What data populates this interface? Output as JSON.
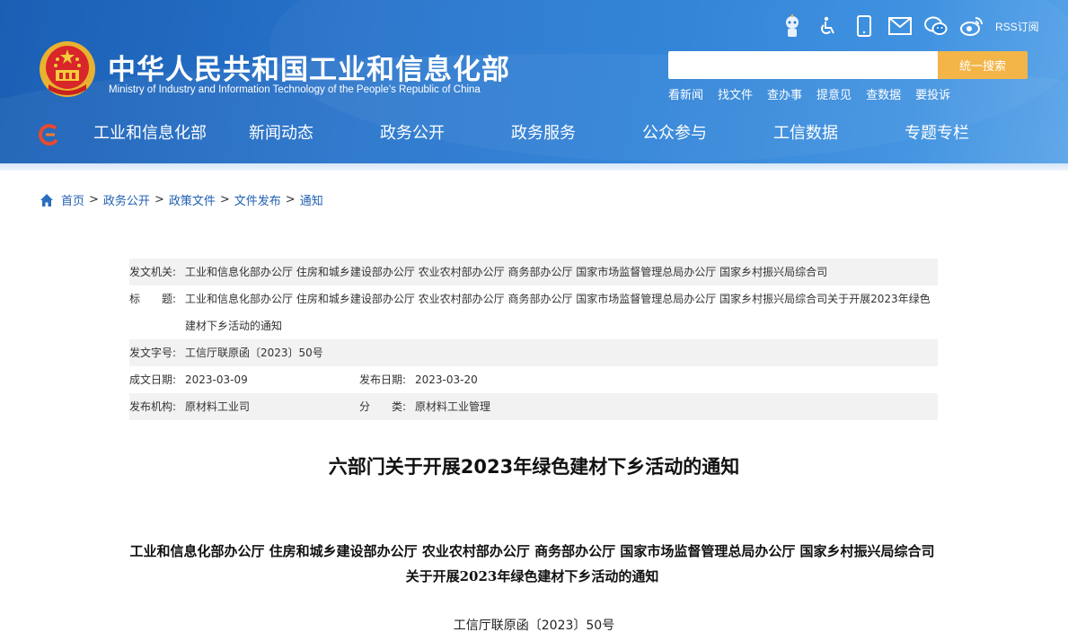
{
  "header": {
    "title": "中华人民共和国工业和信息化部",
    "subtitle": "Ministry of Industry and Information Technology of the People’s Republic of China",
    "rss_label": "RSS订阅",
    "tool_icons": [
      "robot-assistant-icon",
      "accessibility-icon",
      "mobile-icon",
      "mail-icon",
      "wechat-icon",
      "weibo-icon"
    ],
    "search": {
      "placeholder": "",
      "button_label": "统一搜索"
    },
    "quick_links": [
      "看新闻",
      "找文件",
      "查办事",
      "提意见",
      "查数据",
      "要投诉"
    ],
    "nav": [
      "工业和信息化部",
      "新闻动态",
      "政务公开",
      "政务服务",
      "公众参与",
      "工信数据",
      "专题专栏"
    ]
  },
  "breadcrumb": [
    "首页",
    "政务公开",
    "政策文件",
    "文件发布",
    "通知"
  ],
  "meta": {
    "issuer_label": "发文机关:",
    "issuer": "工业和信息化部办公厅 住房和城乡建设部办公厅 农业农村部办公厅 商务部办公厅 国家市场监督管理总局办公厅 国家乡村振兴局综合司",
    "title_label": "标　　题:",
    "title": "工业和信息化部办公厅 住房和城乡建设部办公厅 农业农村部办公厅 商务部办公厅 国家市场监督管理总局办公厅 国家乡村振兴局综合司关于开展2023年绿色建材下乡活动的通知",
    "doc_no_label": "发文字号:",
    "doc_no": "工信厅联原函〔2023〕50号",
    "created_label": "成文日期:",
    "created": "2023-03-09",
    "published_label": "发布日期:",
    "published": "2023-03-20",
    "org_label": "发布机构:",
    "org": "原材料工业司",
    "category_label": "分　　类:",
    "category": "原材料工业管理"
  },
  "document": {
    "title": "六部门关于开展2023年绿色建材下乡活动的通知",
    "subtitle": "工业和信息化部办公厅  住房和城乡建设部办公厅  农业农村部办公厅  商务部办公厅  国家市场监督管理总局办公厅  国家乡村振兴局综合司关于开展2023年绿色建材下乡活动的通知",
    "number": "工信厅联原函〔2023〕50号"
  },
  "colors": {
    "header_blue": "#2874cc",
    "search_button": "#f3b548",
    "link_blue": "#1f5fb0",
    "row_shade": "#f2f2f2"
  }
}
